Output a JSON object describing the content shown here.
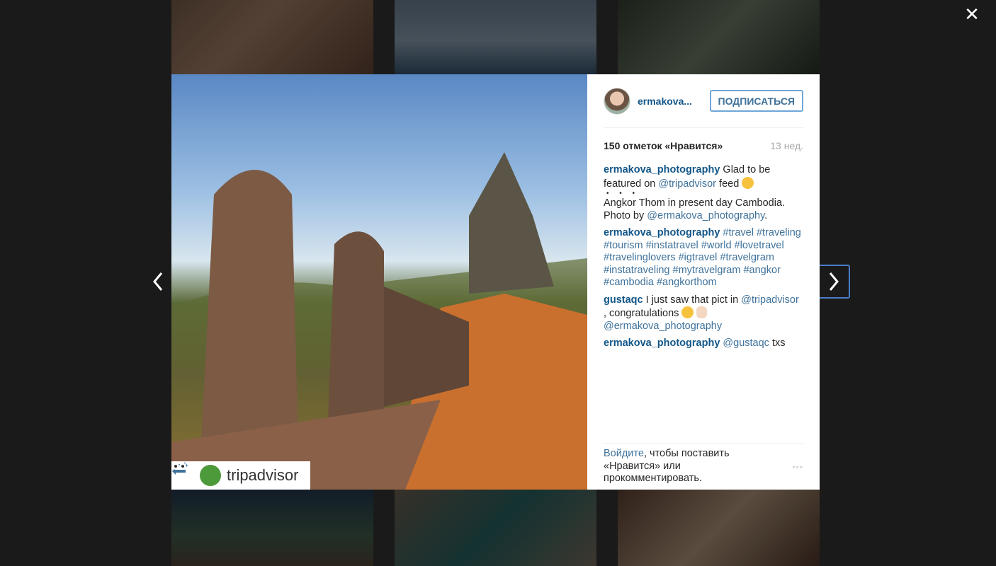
{
  "modal": {
    "close_glyph": "✕",
    "prev_glyph": "‹",
    "next_glyph": "›"
  },
  "post": {
    "badge": {
      "text": "tripadvisor",
      "repost_icon": "repost-icon",
      "logo_icon": "tripadvisor-owl-logo"
    },
    "author": "ermakova...",
    "follow_label": "ПОДПИСАТЬСЯ",
    "likes": "150 отметок «Нравится»",
    "time": "13 нед."
  },
  "comments": [
    {
      "user": "ermakova_photography",
      "text_before": " Glad to be featured on ",
      "mention": "@tripadvisor",
      "text_after": " feed ",
      "dots": "• • •",
      "text2": "Angkor Thom in present day Cambodia. Photo by ",
      "mention2": "@ermakova_photography",
      "text3": "."
    },
    {
      "user": "ermakova_photography",
      "hashtags": "#travel #traveling #tourism #instatravel #world #lovetravel #travelinglovers #igtravel #travelgram #instatraveling #mytravelgram #angkor #cambodia #angkorthom"
    },
    {
      "user": "gustaqc",
      "text_before": " I just saw that pict in ",
      "mention": "@tripadvisor",
      "text_after": " , congratulations ",
      "mention2": "@ermakova_photography"
    },
    {
      "user": "ermakova_photography",
      "mention": "@gustaqc",
      "text_after": " txs"
    }
  ],
  "footer": {
    "login_link": "Войдите",
    "login_text": ", чтобы поставить «Нравится» или прокомментировать.",
    "more_glyph": "◦◦◦"
  }
}
